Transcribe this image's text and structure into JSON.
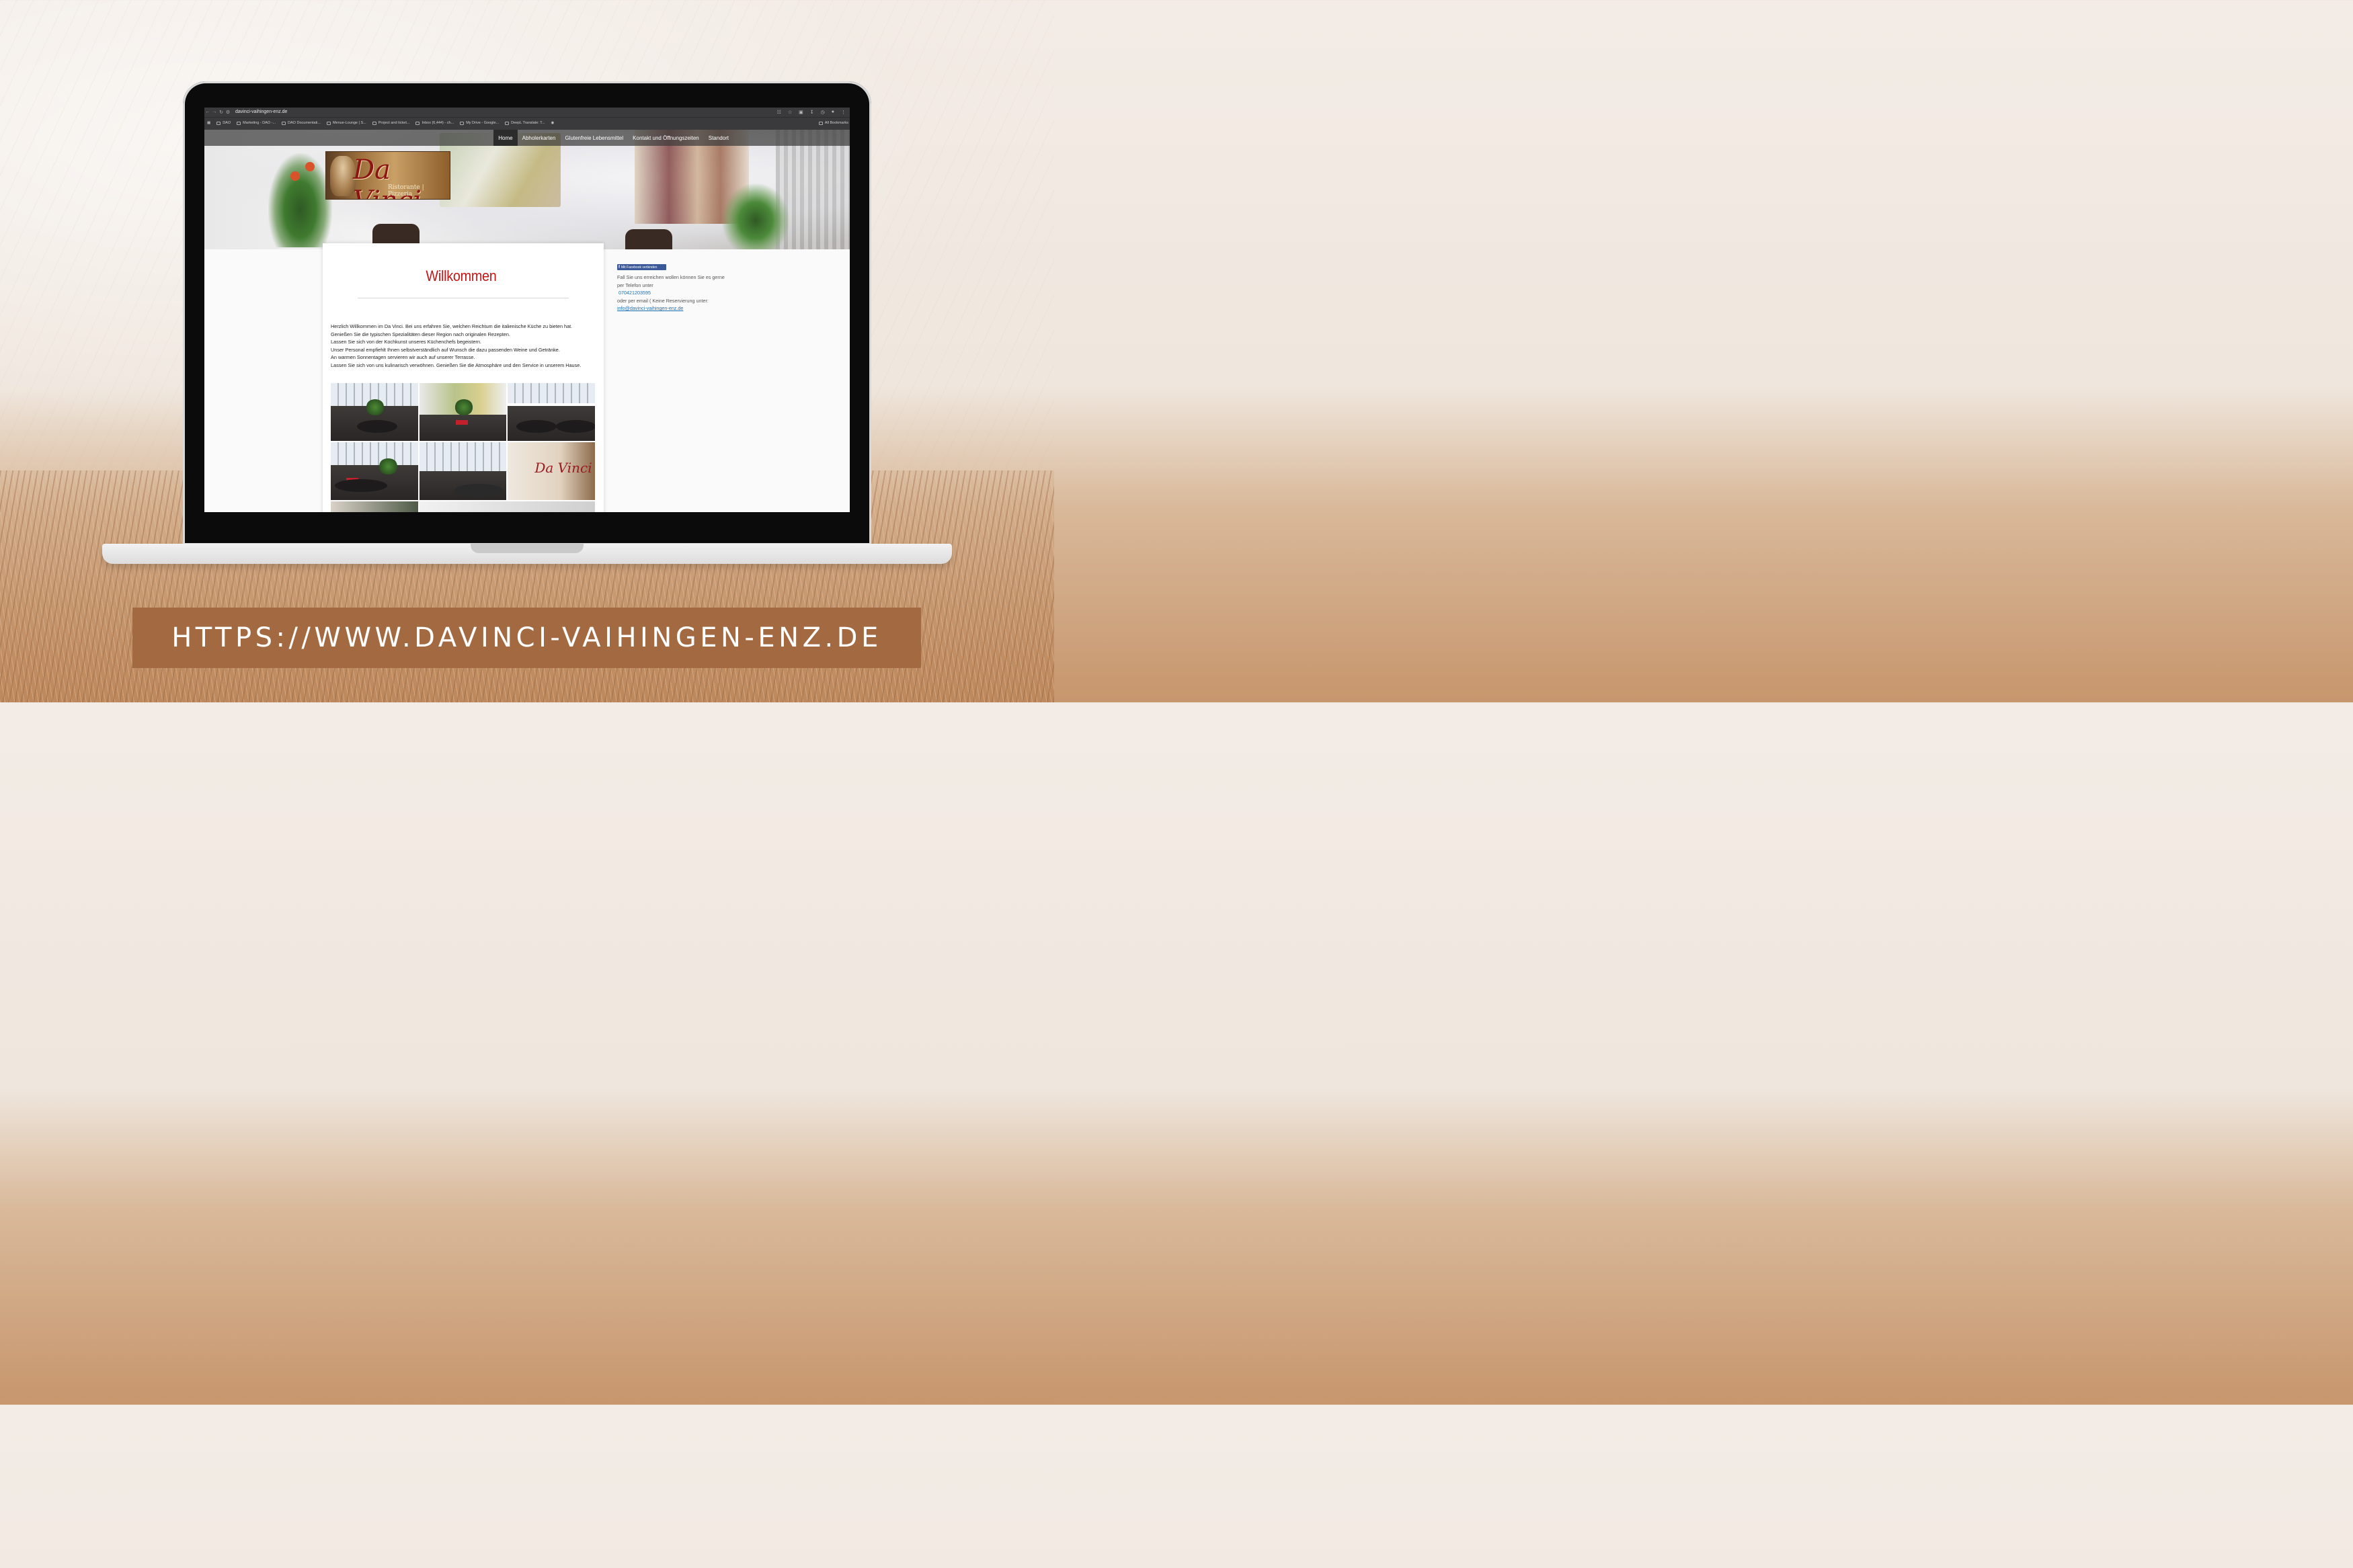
{
  "browser": {
    "url": "davinci-vaihingen-enz.de",
    "bookmarks": [
      "DAO",
      "Marketing - DAO -...",
      "DAO Documentati...",
      "Menue-Lounge | S...",
      "Project and ticket...",
      "Inbox (6,444) - ch...",
      "My Drive - Google...",
      "DeepL Translate: T..."
    ],
    "all_bookmarks": "All Bookmarks"
  },
  "site": {
    "nav": [
      "Home",
      "Abholerkarten",
      "Glutenfreie Lebensmittel",
      "Kontakt und Öffnungszeiten",
      "Standort"
    ],
    "logo": {
      "title": "Da Vinci",
      "subtitle": "Ristorante | Pizzeria"
    },
    "heading": "Willkommen",
    "intro_lines": [
      "Herzlich Willkommen im Da Vinci. Bei uns erfahren Sie, welchen Reichtum die italienische Küche zu bieten hat.",
      "Genießen Sie die typischen Spezialitäten dieser Region nach originalen Rezepten.",
      "Lassen Sie sich von der Kochkunst unseres Küchenchefs begeistern.",
      "Unser Personal empfiehlt Ihnen selbstverständlich auf Wunsch die dazu passenden Weine und Getränke.",
      "An warmen Sonnentagen servieren wir auch auf unserer Terrasse.",
      "Lassen Sie sich von uns kulinarisch verwöhnen. Genießen Sie die Atmosphäre und den Service in unserem Hause."
    ],
    "sidebar": {
      "facebook_button": "Mit Facebook verbinden",
      "contact_line1": "Fall Sie uns erreichen wollen können Sie es gerne per Telefon unter",
      "phone": "070421203595",
      "contact_line2": "oder per email ( Keine Reservierung    unter:",
      "email": "info@davinci-vaihingen-enz.de"
    },
    "gallery_logo_text": "Da Vinci"
  },
  "banner": {
    "text": "HTTPS://WWW.DAVINCI-VAIHINGEN-ENZ.DE"
  },
  "colors": {
    "banner": "#a36a42",
    "heading": "#c41616",
    "link": "#1b6fb3",
    "facebook": "#3b5998"
  }
}
